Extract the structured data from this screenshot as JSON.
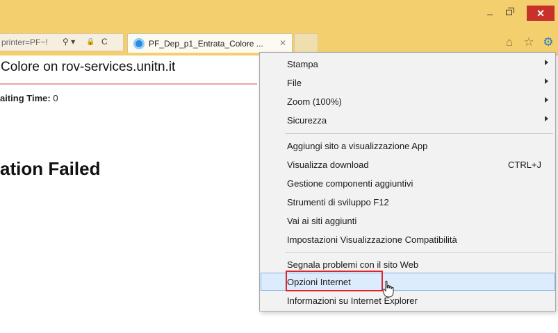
{
  "window": {
    "minimize_glyph": "–",
    "close_glyph": "✕"
  },
  "address_bar": {
    "text": "printer=PF~!",
    "search_glyph": "⚲ ▾",
    "lock_glyph": "🔒",
    "refresh_glyph": "C"
  },
  "tab": {
    "title": "PF_Dep_p1_Entrata_Colore ...",
    "close_glyph": "✕"
  },
  "nav_icons": {
    "home_glyph": "⌂",
    "favorites_glyph": "☆",
    "tools_glyph": "⚙"
  },
  "page": {
    "heading": "Colore on rov-services.unitn.it",
    "waiting_label": "aiting Time:",
    "waiting_value": "0",
    "failed_text": "ation Failed"
  },
  "menu": {
    "items": [
      {
        "label": "Stampa",
        "submenu": true
      },
      {
        "label": "File",
        "submenu": true
      },
      {
        "label": "Zoom (100%)",
        "submenu": true
      },
      {
        "label": "Sicurezza",
        "submenu": true
      },
      {
        "label": "Aggiungi sito a visualizzazione App"
      },
      {
        "label": "Visualizza download",
        "shortcut": "CTRL+J"
      },
      {
        "label": "Gestione componenti aggiuntivi"
      },
      {
        "label": "Strumenti di sviluppo F12"
      },
      {
        "label": "Vai ai siti aggiunti"
      },
      {
        "label": "Impostazioni Visualizzazione Compatibilità"
      },
      {
        "label": "Segnala problemi con il sito Web"
      },
      {
        "label": "Opzioni Internet",
        "highlighted": true
      },
      {
        "label": "Informazioni su Internet Explorer"
      }
    ]
  },
  "colors": {
    "titlebar": "#f3cf6e",
    "close_button": "#c7312a",
    "menu_hover": "#dcecfc",
    "highlight_box": "#e0232a"
  }
}
